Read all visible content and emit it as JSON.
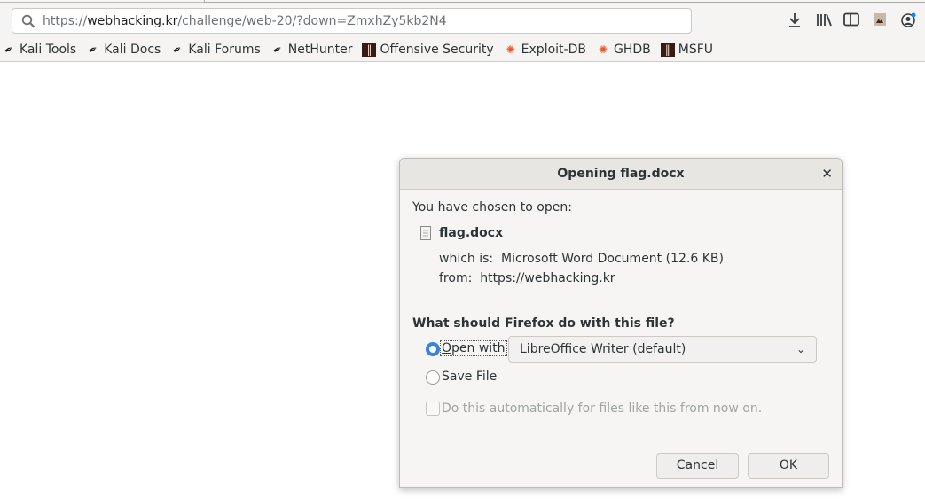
{
  "browser": {
    "url_scheme": "https://",
    "url_domain": "webhacking.kr",
    "url_path": "/challenge/web-20/?down=ZmxhZy5kb2N4",
    "toolbar_icons": [
      "download-icon",
      "library-icon",
      "sidebar-icon",
      "screenshot-extension-icon",
      "account-icon"
    ],
    "bookmarks": [
      {
        "label": "Kali Tools",
        "icon": "kali-dragon-icon"
      },
      {
        "label": "Kali Docs",
        "icon": "kali-dragon-icon"
      },
      {
        "label": "Kali Forums",
        "icon": "kali-dragon-icon"
      },
      {
        "label": "NetHunter",
        "icon": "kali-dragon-icon"
      },
      {
        "label": "Offensive Security",
        "icon": "offsec-icon"
      },
      {
        "label": "Exploit-DB",
        "icon": "exploit-db-icon"
      },
      {
        "label": "GHDB",
        "icon": "exploit-db-icon"
      },
      {
        "label": "MSFU",
        "icon": "offsec-icon"
      }
    ]
  },
  "dialog": {
    "title": "Opening flag.docx",
    "intro": "You have chosen to open:",
    "filename": "flag.docx",
    "which_is_label": "which is:",
    "which_is_value": "Microsoft Word Document (12.6 KB)",
    "from_label": "from:",
    "from_value": "https://webhacking.kr",
    "question": "What should Firefox do with this file?",
    "open_with_label": "Open with",
    "open_with_selected": true,
    "app_selected": "LibreOffice Writer (default)",
    "save_file_label": "Save File",
    "auto_label": "Do this automatically for files like this from now on.",
    "auto_checked": false,
    "cancel_label": "Cancel",
    "ok_label": "OK",
    "accent_color": "#3584e4"
  }
}
